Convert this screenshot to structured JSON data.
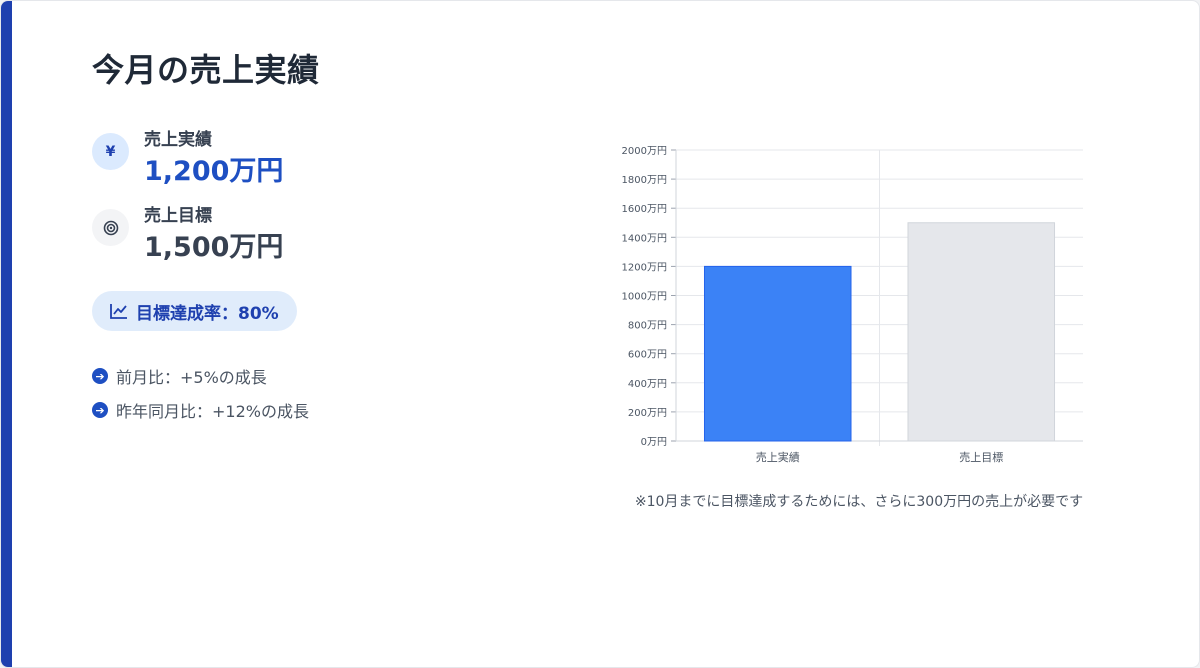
{
  "page": {
    "title": "今月の売上実績"
  },
  "metrics": {
    "sales": {
      "icon": "yen-icon",
      "icon_glyph": "¥",
      "label": "売上実績",
      "value": "1,200万円"
    },
    "target": {
      "icon": "target-icon",
      "label": "売上目標",
      "value": "1,500万円"
    }
  },
  "achievement": {
    "icon": "trend-chart-icon",
    "text": "目標達成率：80%"
  },
  "notes": [
    {
      "icon": "arrow-right-circle-icon",
      "text": "前月比：+5%の成長"
    },
    {
      "icon": "arrow-right-circle-icon",
      "text": "昨年同月比：+12%の成長"
    }
  ],
  "chart_note": "※10月までに目標達成するためには、さらに300万円の売上が必要です",
  "colors": {
    "accent": "#1e40af",
    "primary": "#1e4fc2",
    "bar_actual": "#3b82f6",
    "bar_target": "#e5e7eb"
  },
  "chart_data": {
    "type": "bar",
    "categories": [
      "売上実績",
      "売上目標"
    ],
    "values": [
      1200,
      1500
    ],
    "bar_colors": [
      "#3b82f6",
      "#e5e7eb"
    ],
    "ylim": [
      0,
      2000
    ],
    "yticks": [
      0,
      200,
      400,
      600,
      800,
      1000,
      1200,
      1400,
      1600,
      1800,
      2000
    ],
    "ytick_labels": [
      "0万円",
      "200万円",
      "400万円",
      "600万円",
      "800万円",
      "1000万円",
      "1200万円",
      "1400万円",
      "1600万円",
      "1800万円",
      "2000万円"
    ],
    "title": "",
    "xlabel": "",
    "ylabel": "",
    "grid": true,
    "legend": "none"
  }
}
